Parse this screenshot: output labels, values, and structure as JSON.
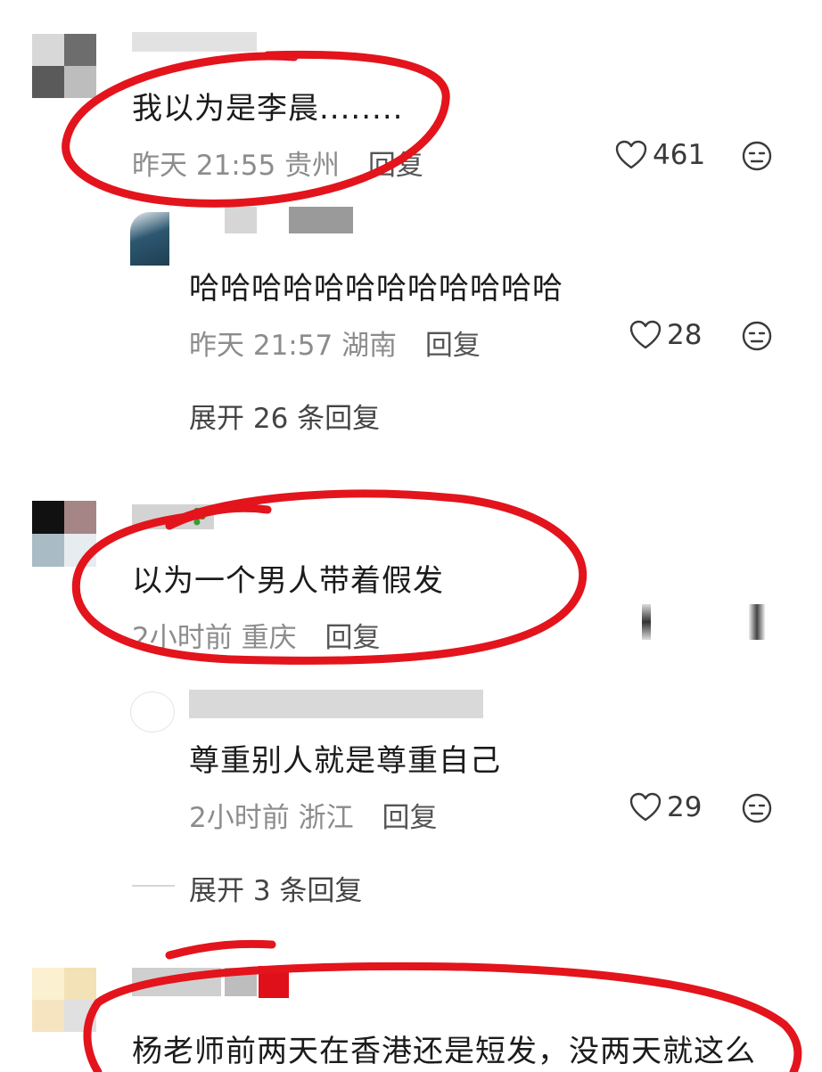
{
  "comments": [
    {
      "text": "我以为是李晨........",
      "time": "昨天 21:55",
      "location": "贵州",
      "reply_label": "回复",
      "likes": "461",
      "reply": {
        "text": "哈哈哈哈哈哈哈哈哈哈哈哈",
        "time": "昨天 21:57",
        "location": "湖南",
        "reply_label": "回复",
        "likes": "28"
      },
      "expand_label": "展开 26 条回复"
    },
    {
      "text": "以为一个男人带着假发",
      "time": "2小时前",
      "location": "重庆",
      "reply_label": "回复",
      "reply": {
        "text": "尊重别人就是尊重自己",
        "time": "2小时前",
        "location": "浙江",
        "reply_label": "回复",
        "likes": "29"
      },
      "expand_label": "展开 3 条回复"
    },
    {
      "text": "杨老师前两天在香港还是短发，没两天就这么"
    }
  ],
  "icons": {
    "like": "heart-outline-icon",
    "dislike": "neutral-face-icon"
  },
  "colors": {
    "annotation_red": "#e3141c",
    "meta_gray": "#8c8c8c"
  }
}
